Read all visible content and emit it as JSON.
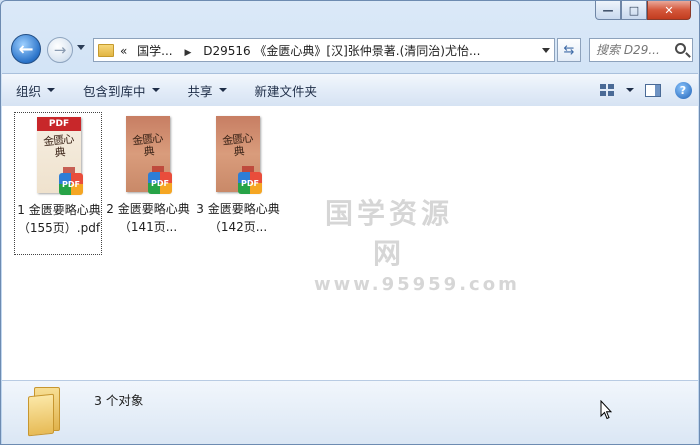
{
  "window": {
    "minimize_glyph": "—",
    "maximize_glyph": "□",
    "close_glyph": "✕"
  },
  "nav": {
    "back_glyph": "←",
    "forward_glyph": "→",
    "refresh_glyph": "⇆"
  },
  "address": {
    "prefix": "«",
    "segment1": "国学...",
    "separator": "▶",
    "segment2": "D29516 《金匮心典》[汉]张仲景著.(清同治)尤怡..."
  },
  "search": {
    "placeholder": "搜索 D29..."
  },
  "toolbar": {
    "organize": "组织",
    "include_in_library": "包含到库中",
    "share": "共享",
    "new_folder": "新建文件夹",
    "help_glyph": "?"
  },
  "files": [
    {
      "label": "1 金匮要略心典（155页）.pdf",
      "thumb_header": "PDF",
      "callig": "金匮心典",
      "badge": "PDF",
      "selected": true
    },
    {
      "label": "2 金匮要略心典（141页...",
      "thumb_header": "",
      "callig": "金匮心典",
      "badge": "PDF",
      "selected": false
    },
    {
      "label": "3 金匮要略心典（142页...",
      "thumb_header": "",
      "callig": "金匮心典",
      "badge": "PDF",
      "selected": false
    }
  ],
  "watermark": {
    "line1": "国学资源网",
    "line2": "www.95959.com"
  },
  "details": {
    "count_text": "3 个对象"
  }
}
